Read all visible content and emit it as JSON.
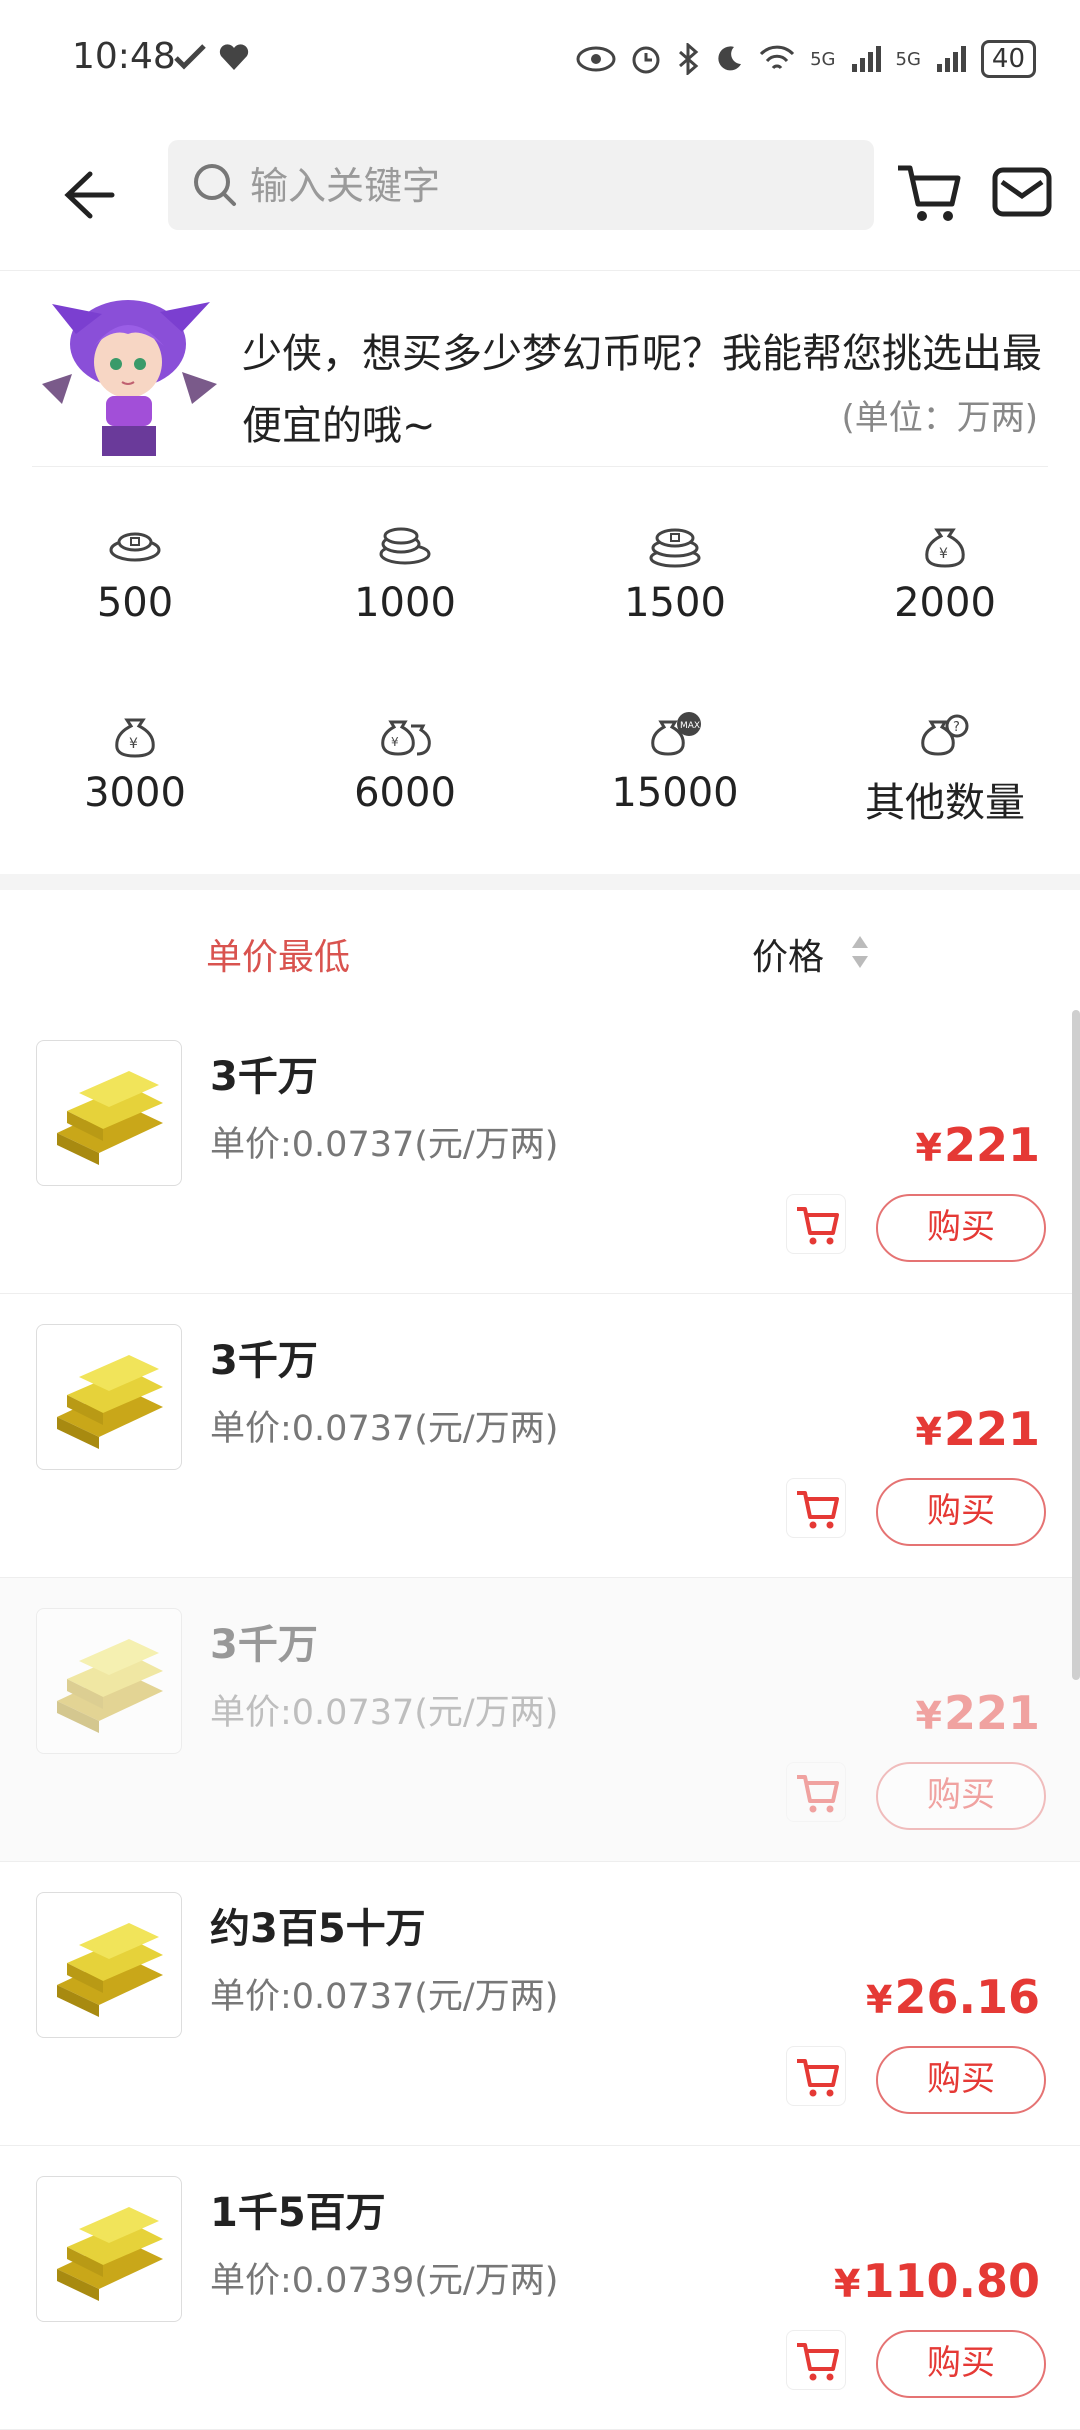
{
  "status": {
    "time": "10:48",
    "battery": "40",
    "signal1": "5G",
    "signal2": "5G"
  },
  "search": {
    "placeholder": "输入关键字"
  },
  "assistant": {
    "message": "少侠，想买多少梦幻币呢？我能帮您挑选出最便宜的哦~",
    "unit": "(单位：万两)"
  },
  "amounts": [
    {
      "label": "500",
      "icon": "coins-small-icon"
    },
    {
      "label": "1000",
      "icon": "coins-stack-icon"
    },
    {
      "label": "1500",
      "icon": "coins-pile-icon"
    },
    {
      "label": "2000",
      "icon": "money-bag-icon"
    },
    {
      "label": "3000",
      "icon": "money-bag-icon"
    },
    {
      "label": "6000",
      "icon": "money-bags-icon"
    },
    {
      "label": "15000",
      "icon": "money-bag-max-icon"
    },
    {
      "label": "其他数量",
      "icon": "money-bag-question-icon"
    }
  ],
  "sort": {
    "lowest": "单价最低",
    "price": "价格"
  },
  "listings": [
    {
      "title": "3千万",
      "unit_price": "单价:0.0737(元/万两)",
      "currency": "¥",
      "price": "221",
      "buy": "购买"
    },
    {
      "title": "3千万",
      "unit_price": "单价:0.0737(元/万两)",
      "currency": "¥",
      "price": "221",
      "buy": "购买"
    },
    {
      "title": "3千万",
      "unit_price": "单价:0.0737(元/万两)",
      "currency": "¥",
      "price": "221",
      "buy": "购买"
    },
    {
      "title": "约3百5十万",
      "unit_price": "单价:0.0737(元/万两)",
      "currency": "¥",
      "price": "26.16",
      "buy": "购买"
    },
    {
      "title": "1千5百万",
      "unit_price": "单价:0.0739(元/万两)",
      "currency": "¥",
      "price": "110.80",
      "buy": "购买"
    }
  ],
  "colors": {
    "accent": "#e53935",
    "sort_active": "#d9534f",
    "gold": "#e6c229"
  }
}
